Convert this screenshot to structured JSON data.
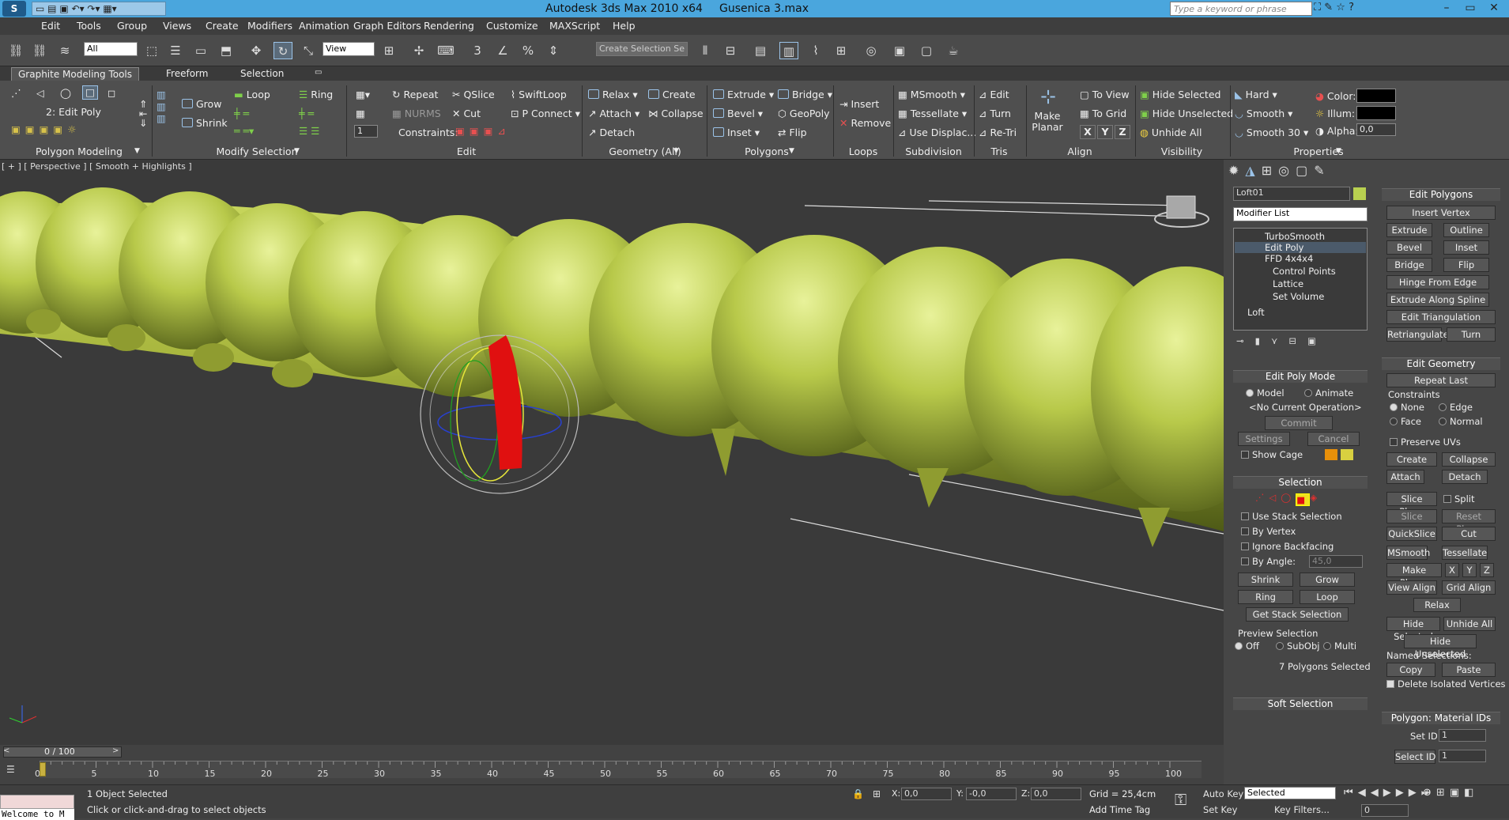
{
  "app": {
    "title": "Autodesk 3ds Max  2010 x64",
    "file": "Gusenica 3.max",
    "search_placeholder": "Type a keyword or phrase"
  },
  "menu": [
    "Edit",
    "Tools",
    "Group",
    "Views",
    "Create",
    "Modifiers",
    "Animation",
    "Graph Editors",
    "Rendering",
    "Customize",
    "MAXScript",
    "Help"
  ],
  "toolbar": {
    "filter": "All",
    "refcoord": "View",
    "selset": "Create Selection Se"
  },
  "ribbon_tabs": [
    "Graphite Modeling Tools",
    "Freeform",
    "Selection"
  ],
  "ribbon": {
    "poly_modeling": {
      "level": "2: Edit Poly",
      "label": "Polygon Modeling"
    },
    "modify_selection": {
      "grow": "Grow",
      "shrink": "Shrink",
      "loop": "Loop",
      "ring": "Ring",
      "label": "Modify Selection"
    },
    "edit": {
      "repeat": "Repeat",
      "nurms": "NURMS",
      "qslice": "QSlice",
      "cut": "Cut",
      "swiftloop": "SwiftLoop",
      "pconnect": "P Connect",
      "constraints": "Constraints:",
      "spin": "1",
      "label": "Edit"
    },
    "geometry": {
      "relax": "Relax",
      "attach": "Attach",
      "detach": "Detach",
      "create": "Create",
      "collapse": "Collapse",
      "label": "Geometry (All)"
    },
    "polygons": {
      "extrude": "Extrude",
      "bevel": "Bevel",
      "inset": "Inset",
      "bridge": "Bridge",
      "geopoly": "GeoPoly",
      "flip": "Flip",
      "label": "Polygons"
    },
    "loops": {
      "insert": "Insert",
      "remove": "Remove",
      "label": "Loops"
    },
    "subdivision": {
      "msmooth": "MSmooth",
      "tessellate": "Tessellate",
      "usedisp": "Use Displac...",
      "label": "Subdivision"
    },
    "tris": {
      "edit": "Edit",
      "turn": "Turn",
      "retri": "Re-Tri",
      "label": "Tris"
    },
    "align": {
      "make_planar": "Make Planar",
      "toview": "To View",
      "togrid": "To Grid",
      "x": "X",
      "y": "Y",
      "z": "Z",
      "label": "Align"
    },
    "visibility": {
      "hide_sel": "Hide Selected",
      "hide_unsel": "Hide Unselected",
      "unhide": "Unhide All",
      "label": "Visibility"
    },
    "properties": {
      "hard": "Hard",
      "smooth": "Smooth",
      "smooth30": "Smooth 30",
      "color": "Color:",
      "illum": "Illum:",
      "alpha": "Alpha:",
      "alpha_val": "0,0",
      "label": "Properties"
    }
  },
  "viewport": {
    "label": "[ + ] [ Perspective ] [ Smooth + Highlights ]"
  },
  "cmd": {
    "object_name": "Loft01",
    "modifier_list": "Modifier List",
    "stack": [
      "TurboSmooth",
      "Edit Poly",
      "FFD 4x4x4",
      "Control Points",
      "Lattice",
      "Set Volume",
      "Loft"
    ],
    "editpolymode": {
      "title": "Edit Poly Mode",
      "model": "Model",
      "animate": "Animate",
      "noop": "<No Current Operation>",
      "commit": "Commit",
      "settings": "Settings",
      "cancel": "Cancel",
      "showcage": "Show Cage"
    },
    "selection": {
      "title": "Selection",
      "usestack": "Use Stack Selection",
      "byvertex": "By Vertex",
      "ignoreback": "Ignore Backfacing",
      "byangle": "By Angle:",
      "angle": "45,0",
      "shrink": "Shrink",
      "grow": "Grow",
      "ring": "Ring",
      "loop": "Loop",
      "getstack": "Get Stack Selection",
      "preview": "Preview Selection",
      "off": "Off",
      "subobj": "SubObj",
      "multi": "Multi",
      "count": "7 Polygons Selected"
    },
    "softsel": "Soft Selection",
    "editpolys": {
      "title": "Edit Polygons",
      "insertvertex": "Insert Vertex",
      "extrude": "Extrude",
      "outline": "Outline",
      "bevel": "Bevel",
      "inset": "Inset",
      "bridge": "Bridge",
      "flip": "Flip",
      "hinge": "Hinge From Edge",
      "extspline": "Extrude Along Spline",
      "edittri": "Edit Triangulation",
      "retri": "Retriangulate",
      "turn": "Turn"
    },
    "editgeo": {
      "title": "Edit Geometry",
      "repeat": "Repeat Last",
      "constraints": "Constraints",
      "none": "None",
      "edge": "Edge",
      "face": "Face",
      "normal": "Normal",
      "preserve": "Preserve UVs",
      "create": "Create",
      "collapse": "Collapse",
      "attach": "Attach",
      "detach": "Detach",
      "sliceplane": "Slice Plane",
      "split": "Split",
      "slice": "Slice",
      "resetplane": "Reset Plane",
      "quickslice": "QuickSlice",
      "cut": "Cut",
      "msmooth": "MSmooth",
      "tessellate": "Tessellate",
      "makeplanar": "Make Planar",
      "x": "X",
      "y": "Y",
      "z": "Z",
      "viewalign": "View Align",
      "gridalign": "Grid Align",
      "relax": "Relax",
      "hidesel": "Hide Selected",
      "unhide": "Unhide All",
      "hideunsel": "Hide Unselected",
      "named": "Named Selections:",
      "copy": "Copy",
      "paste": "Paste",
      "deliso": "Delete Isolated Vertices"
    },
    "matids": {
      "title": "Polygon: Material IDs",
      "setid": "Set ID:",
      "setid_val": "1",
      "selid": "Select ID",
      "selid_val": "1"
    }
  },
  "timeline": {
    "frame": "0 / 100",
    "ticks": [
      "0",
      "5",
      "10",
      "15",
      "20",
      "25",
      "30",
      "35",
      "40",
      "45",
      "50",
      "55",
      "60",
      "65",
      "70",
      "75",
      "80",
      "85",
      "90",
      "95",
      "100"
    ]
  },
  "status": {
    "welcome": "Welcome to M",
    "selected": "1 Object Selected",
    "prompt": "Click or click-and-drag to select objects",
    "x": "0,0",
    "y": "-0,0",
    "z": "0,0",
    "grid": "Grid = 25,4cm",
    "autokey": "Auto Key",
    "setkey": "Set Key",
    "keymode": "Selected",
    "keyfilters": "Key Filters...",
    "addtimetag": "Add Time Tag",
    "frame": "0"
  },
  "colors": {
    "title_bar": "#4aa6dd",
    "body_green": "#b8c94a",
    "sel_red": "#e01010"
  }
}
